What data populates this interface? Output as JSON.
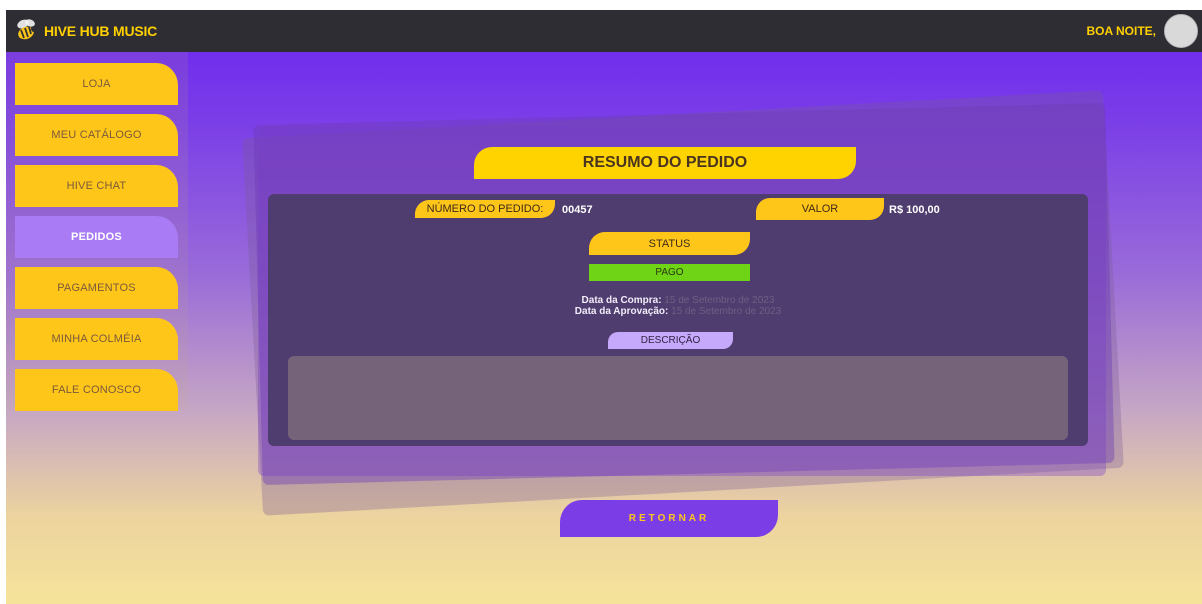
{
  "header": {
    "app_name": "HIVE HUB MUSIC",
    "greeting": "BOA NOITE,",
    "logo_icon": "bee-icon"
  },
  "sidebar": {
    "items": [
      {
        "label": "LOJA",
        "active": false
      },
      {
        "label": "MEU CATÁLOGO",
        "active": false
      },
      {
        "label": "HIVE CHAT",
        "active": false
      },
      {
        "label": "PEDIDOS",
        "active": true
      },
      {
        "label": "PAGAMENTOS",
        "active": false
      },
      {
        "label": "MINHA COLMÉIA",
        "active": false
      },
      {
        "label": "FALE CONOSCO",
        "active": false
      }
    ]
  },
  "order": {
    "title": "RESUMO DO PEDIDO",
    "number_label": "NÚMERO DO PEDIDO:",
    "number_value": "00457",
    "value_label": "VALOR",
    "value_amount": "R$ 100,00",
    "status_label": "STATUS",
    "status_value": "PAGO",
    "purchase_date_label": "Data da Compra:",
    "purchase_date_value": "15 de Setembro de 2023",
    "approval_date_label": "Data da Aprovação:",
    "approval_date_value": "15 de Setembro de 2023",
    "description_label": "DESCRIÇÃO",
    "description_value": ""
  },
  "actions": {
    "return_label": "RETORNAR"
  },
  "colors": {
    "accent_yellow": "#ffc61a",
    "accent_purple": "#7b3ee6",
    "status_paid": "#6fd316",
    "topbar": "#2f2d34"
  }
}
